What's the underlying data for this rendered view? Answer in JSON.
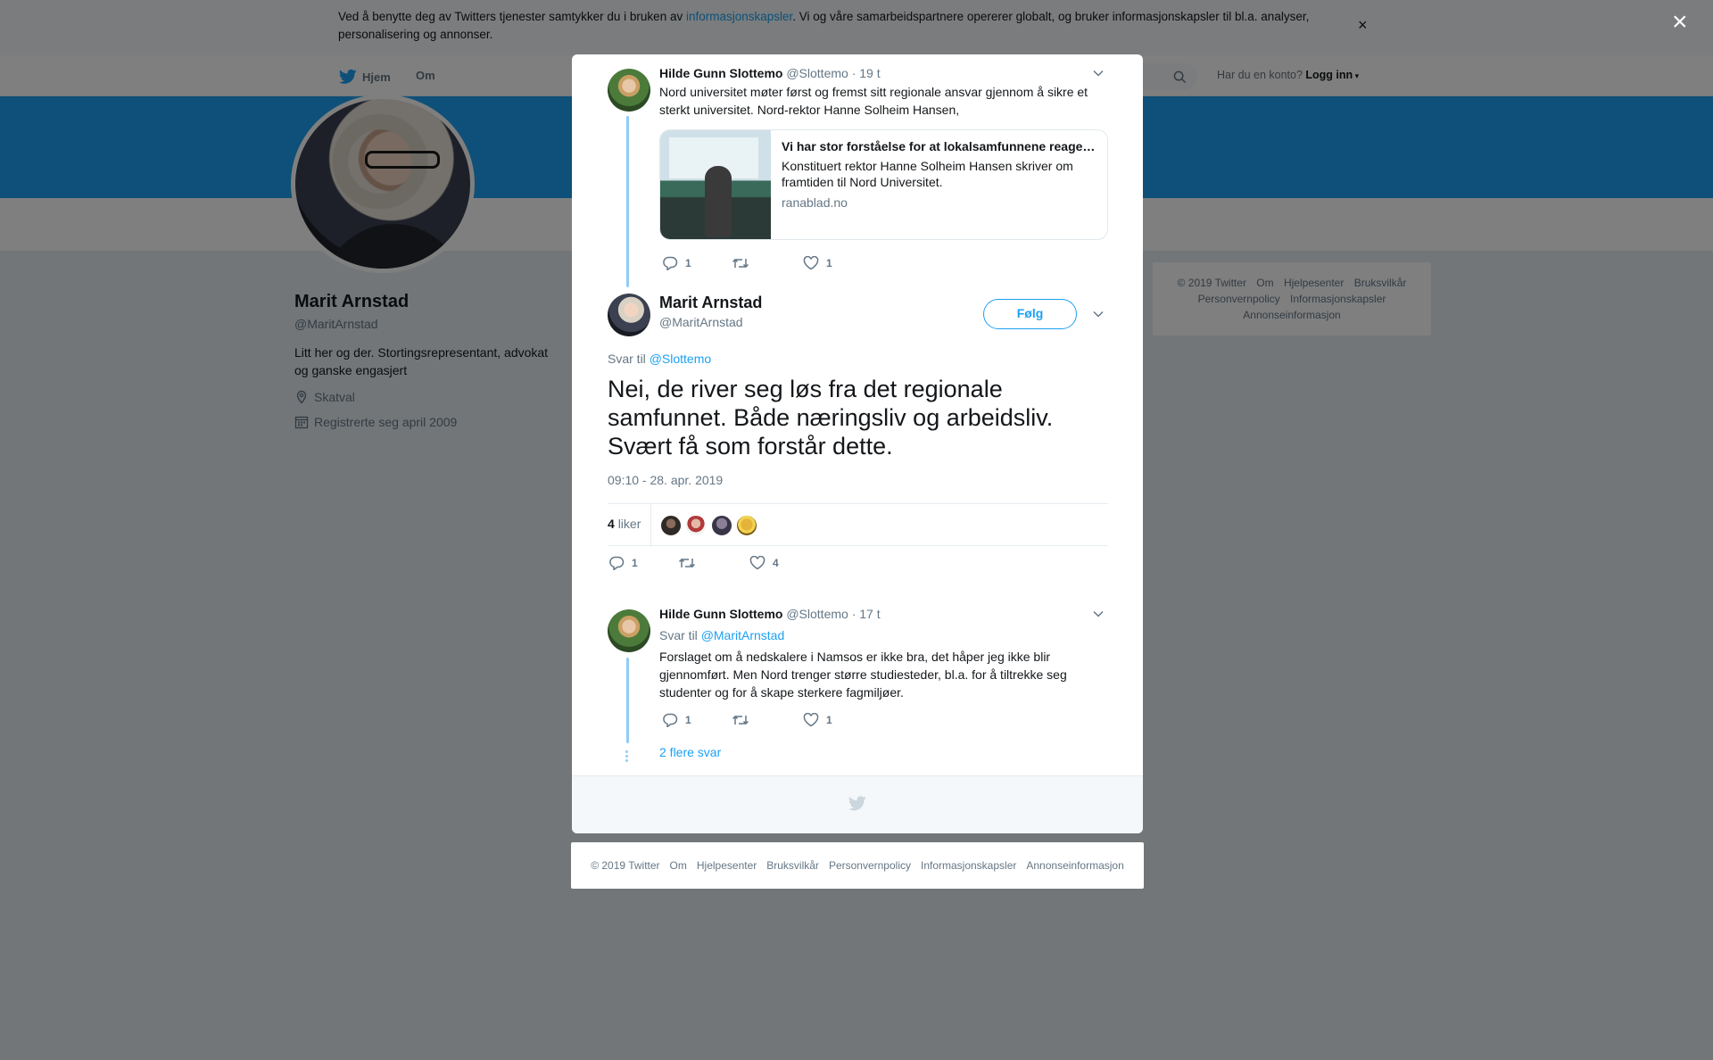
{
  "cookie": {
    "text_before": "Ved å benytte deg av Twitters tjenester samtykker du i bruken av ",
    "link": "informasjonskapsler",
    "text_after": ". Vi og våre samarbeidspartnere opererer globalt, og bruker informasjonskapsler til bl.a. analyser, personalisering og annonser.",
    "close": "×"
  },
  "nav": {
    "home": "Hjem",
    "about": "Om",
    "have_account": "Har du en konto?",
    "login": "Logg inn"
  },
  "profile": {
    "name": "Marit Arnstad",
    "handle": "@MaritArnstad",
    "bio": "Litt her og der. Stortingsrepresentant, advokat og ganske engasjert",
    "location": "Skatval",
    "joined": "Registrerte seg april 2009"
  },
  "side_footer": [
    "© 2019 Twitter",
    "Om",
    "Hjelpesenter",
    "Bruksvilkår",
    "Personvernpolicy",
    "Informasjonskapsler",
    "Annonseinformasjon"
  ],
  "overlay_close": "×",
  "tweet1": {
    "name": "Hilde Gunn Slottemo",
    "handle": "@Slottemo",
    "time": "· 19 t",
    "text": "Nord universitet møter først og fremst sitt regionale ansvar gjennom å sikre et sterkt universitet. Nord-rektor Hanne Solheim Hansen,",
    "card_title": "Vi har stor forståelse for at lokalsamfunnene reagerer",
    "card_desc": "Konstituert rektor Hanne Solheim Hansen skriver om framtiden til Nord Universitet.",
    "card_domain": "ranablad.no",
    "replies": "1",
    "retweets": "",
    "likes": "1"
  },
  "main_tweet": {
    "name": "Marit Arnstad",
    "handle": "@MaritArnstad",
    "follow": "Følg",
    "reply_label": "Svar til ",
    "reply_handle": "@Slottemo",
    "text": "Nei, de river seg løs fra det regionale samfunnet. Både næringsliv og arbeidsliv. Svært få som forstår dette.",
    "timestamp": "09:10 - 28. apr. 2019",
    "likes_number": "4",
    "likes_word": "liker",
    "replies": "1",
    "retweets": "",
    "likes": "4"
  },
  "tweet3": {
    "name": "Hilde Gunn Slottemo",
    "handle": "@Slottemo",
    "time": "· 17 t",
    "reply_label": "Svar til ",
    "reply_handle": "@MaritArnstad",
    "text": "Forslaget om å nedskalere i Namsos er ikke bra, det håper jeg ikke blir gjennomført. Men Nord trenger større studiesteder, bl.a. for å tiltrekke seg studenter og for å skape sterkere fagmiljøer.",
    "replies": "1",
    "retweets": "",
    "likes": "1",
    "more_replies": "2 flere svar"
  },
  "footer": [
    "© 2019 Twitter",
    "Om",
    "Hjelpesenter",
    "Bruksvilkår",
    "Personvernpolicy",
    "Informasjonskapsler",
    "Annonseinformasjon"
  ],
  "colors": {
    "accent": "#1da1f2",
    "thread_line": "#8ecdf8",
    "muted": "#657786"
  }
}
